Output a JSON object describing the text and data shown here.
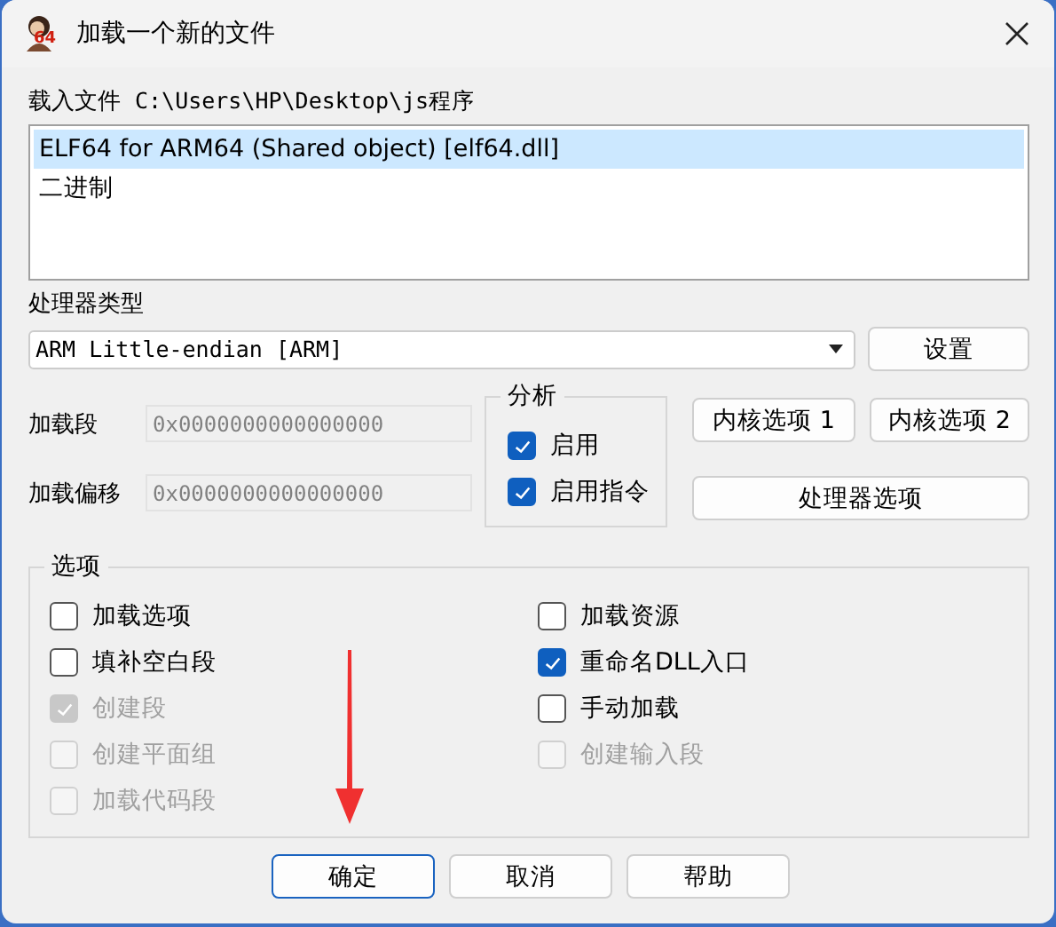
{
  "window": {
    "title": "加载一个新的文件",
    "icon_text": "64"
  },
  "file": {
    "label": "载入文件",
    "path": "C:\\Users\\HP\\Desktop\\js程序"
  },
  "formats": [
    {
      "label": "ELF64 for ARM64 (Shared object) [elf64.dll]",
      "selected": true
    },
    {
      "label": "二进制",
      "selected": false
    }
  ],
  "processor": {
    "label": "处理器类型",
    "value": "ARM Little-endian [ARM]",
    "button": "设置"
  },
  "fields": [
    {
      "label": "加载段",
      "value": "0x0000000000000000",
      "disabled": true
    },
    {
      "label": "加载偏移",
      "value": "0x0000000000000000",
      "disabled": true
    }
  ],
  "analysis": {
    "title": "分析",
    "options": [
      {
        "label": "启用",
        "checked": true,
        "disabled": false
      },
      {
        "label": "启用指令",
        "checked": true,
        "disabled": false
      }
    ]
  },
  "side_buttons": [
    {
      "label": "内核选项 1"
    },
    {
      "label": "内核选项 2"
    },
    {
      "label": "处理器选项"
    }
  ],
  "options": {
    "title": "选项",
    "columns": [
      [
        {
          "label": "加载选项",
          "checked": false,
          "disabled": false
        },
        {
          "label": "填补空白段",
          "checked": false,
          "disabled": false
        },
        {
          "label": "创建段",
          "checked": true,
          "disabled": true
        },
        {
          "label": "创建平面组",
          "checked": false,
          "disabled": true
        },
        {
          "label": "加载代码段",
          "checked": false,
          "disabled": true
        }
      ],
      [
        {
          "label": "加载资源",
          "checked": false,
          "disabled": false
        },
        {
          "label": "重命名DLL入口",
          "checked": true,
          "disabled": false
        },
        {
          "label": "手动加载",
          "checked": false,
          "disabled": false
        },
        {
          "label": "创建输入段",
          "checked": false,
          "disabled": true
        }
      ]
    ]
  },
  "buttons": [
    {
      "label": "确定",
      "default": true
    },
    {
      "label": "取消",
      "default": false
    },
    {
      "label": "帮助",
      "default": false
    }
  ]
}
